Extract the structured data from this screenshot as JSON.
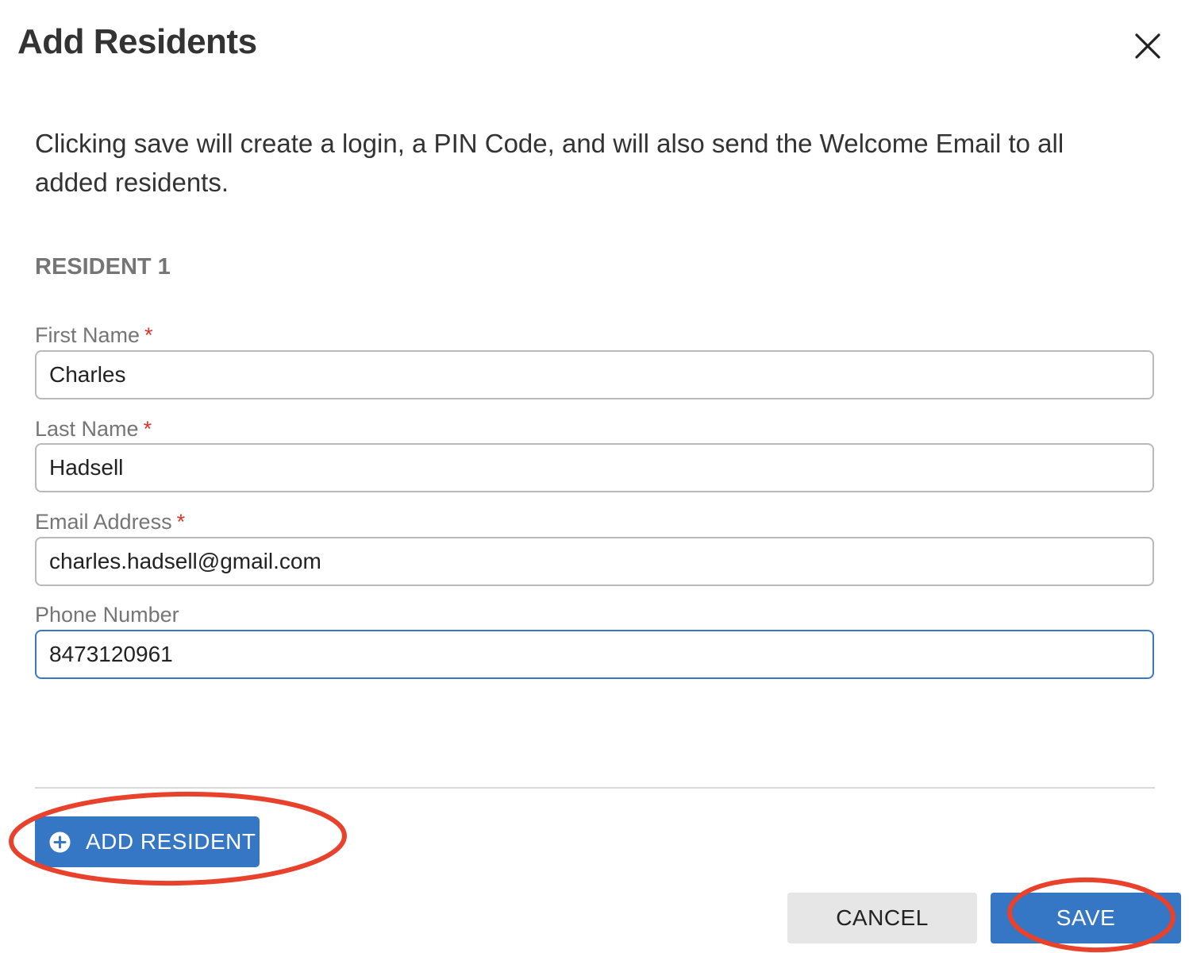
{
  "dialog": {
    "title": "Add Residents",
    "description": "Clicking save will create a login, a PIN Code, and will also send the Welcome Email to all added residents."
  },
  "resident": {
    "heading": "RESIDENT 1",
    "required_marker": "*",
    "fields": {
      "first_name": {
        "label": "First Name",
        "value": "Charles",
        "required": true
      },
      "last_name": {
        "label": "Last Name",
        "value": "Hadsell",
        "required": true
      },
      "email": {
        "label": "Email Address",
        "value": "charles.hadsell@gmail.com",
        "required": true
      },
      "phone": {
        "label": "Phone Number",
        "value": "8473120961",
        "required": false,
        "focused": true
      }
    }
  },
  "actions": {
    "add_resident": "ADD RESIDENT",
    "cancel": "CANCEL",
    "save": "SAVE"
  },
  "icons": {
    "close": "close-icon",
    "add": "plus-circle-icon"
  },
  "colors": {
    "primary": "#3577c4",
    "required": "#d9342b",
    "annotation": "#e8412c",
    "secondary_button": "#e6e6e6"
  }
}
